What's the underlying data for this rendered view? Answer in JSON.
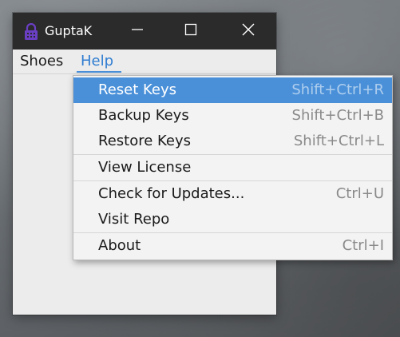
{
  "window": {
    "title": "GuptaK"
  },
  "menubar": {
    "items": [
      {
        "label": "Shoes"
      },
      {
        "label": "Help"
      }
    ]
  },
  "help_menu": {
    "items": [
      {
        "label": "Reset Keys",
        "shortcut": "Shift+Ctrl+R"
      },
      {
        "label": "Backup Keys",
        "shortcut": "Shift+Ctrl+B"
      },
      {
        "label": "Restore Keys",
        "shortcut": "Shift+Ctrl+L"
      },
      {
        "label": "View License",
        "shortcut": ""
      },
      {
        "label": "Check for Updates...",
        "shortcut": "Ctrl+U"
      },
      {
        "label": "Visit Repo",
        "shortcut": ""
      },
      {
        "label": "About",
        "shortcut": "Ctrl+I"
      }
    ]
  },
  "icons": {
    "app": "lock-icon",
    "minimize": "minimize-icon",
    "maximize": "maximize-icon",
    "close": "close-icon"
  },
  "colors": {
    "accent": "#4a90d9",
    "titlebar": "#2b2b2b",
    "app_icon": "#6a3fc4"
  }
}
